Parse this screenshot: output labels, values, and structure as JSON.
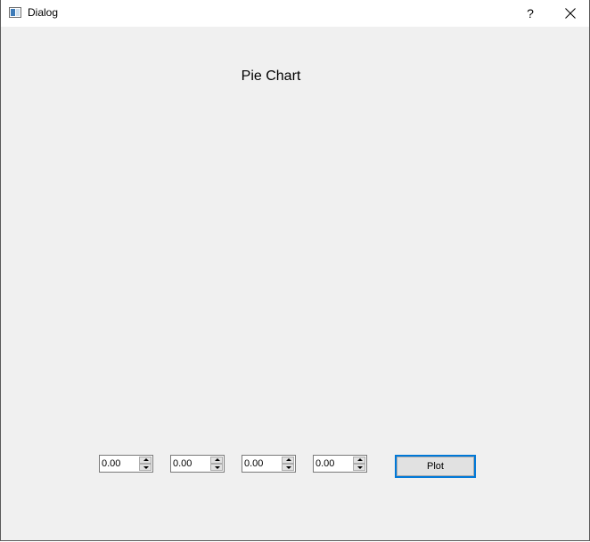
{
  "window": {
    "title": "Dialog",
    "help_label": "?"
  },
  "chart": {
    "title": "Pie Chart"
  },
  "spinboxes": [
    {
      "value": "0.00"
    },
    {
      "value": "0.00"
    },
    {
      "value": "0.00"
    },
    {
      "value": "0.00"
    }
  ],
  "plot_button": {
    "label": "Plot"
  },
  "colors": {
    "accent": "#0078d7",
    "window_bg": "#f0f0f0"
  }
}
